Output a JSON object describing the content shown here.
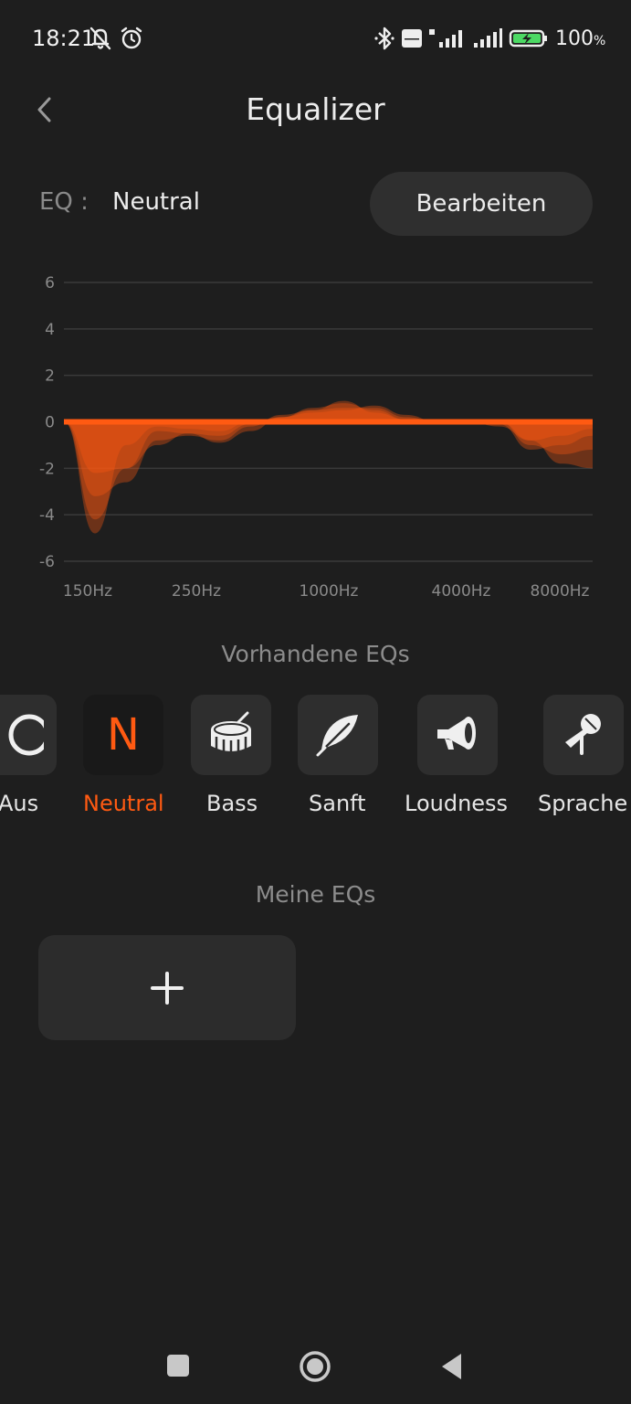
{
  "status_bar": {
    "time": "18:21",
    "battery_percent": "100",
    "battery_unit": "%",
    "icons": [
      "bell-off-icon",
      "alarm-icon",
      "bluetooth-icon",
      "volte-icon",
      "signal-4g-icon",
      "signal-icon",
      "battery-charging-icon"
    ],
    "battery_level": 1.0
  },
  "header": {
    "title": "Equalizer",
    "back_icon": "chevron-left-icon"
  },
  "eq_row": {
    "label": "EQ :",
    "value": "Neutral",
    "edit_button": "Bearbeiten"
  },
  "chart_data": {
    "type": "area",
    "y_ticks": [
      "6",
      "4",
      "2",
      "0",
      "-2",
      "-4",
      "-6"
    ],
    "y_tick_values": [
      6,
      4,
      2,
      0,
      -2,
      -4,
      -6
    ],
    "ylim": [
      -6,
      6
    ],
    "x_labels": [
      "150Hz",
      "250Hz",
      "1000Hz",
      "4000Hz",
      "8000Hz"
    ],
    "grid": true,
    "fill_color": "#ff5a12",
    "series": [
      {
        "values": [
          0,
          -4.8,
          -1.0,
          -0.2,
          -0.3,
          -0.4,
          0,
          0.2,
          0.5,
          0.9,
          0.4,
          0.1,
          0,
          0,
          0,
          -0.8,
          -1.8,
          -2.0
        ]
      },
      {
        "values": [
          0,
          -4.2,
          -2.0,
          -0.4,
          -0.5,
          -0.6,
          -0.1,
          0.2,
          0.6,
          0.8,
          0.5,
          0.1,
          0,
          0,
          0,
          -1.0,
          -1.4,
          -1.2
        ]
      },
      {
        "values": [
          0,
          -3.2,
          -2.6,
          -0.8,
          -0.6,
          -0.8,
          -0.2,
          0.3,
          0.5,
          0.6,
          0.6,
          0.2,
          0,
          0,
          -0.1,
          -1.2,
          -1.0,
          -0.6
        ]
      },
      {
        "values": [
          0,
          -2.2,
          -2.0,
          -1.0,
          -0.5,
          -0.9,
          -0.4,
          0.2,
          0.4,
          0.5,
          0.7,
          0.3,
          0,
          0,
          -0.2,
          -0.8,
          -0.6,
          -0.3
        ]
      }
    ]
  },
  "presets": {
    "title": "Vorhandene EQs",
    "items": [
      {
        "label": "Aus",
        "icon": "circle-off-icon",
        "active": false
      },
      {
        "label": "Neutral",
        "icon": "neutral-n-icon",
        "letter": "N",
        "active": true
      },
      {
        "label": "Bass",
        "icon": "drum-icon",
        "active": false
      },
      {
        "label": "Sanft",
        "icon": "feather-icon",
        "active": false
      },
      {
        "label": "Loudness",
        "icon": "megaphone-icon",
        "active": false
      },
      {
        "label": "Sprache",
        "icon": "microphone-icon",
        "active": false
      }
    ],
    "accent_color": "#ff5a12"
  },
  "my_eqs": {
    "title": "Meine EQs",
    "add_icon": "plus-icon"
  },
  "nav_bar": {
    "icons": [
      "recents-square-icon",
      "home-circle-icon",
      "back-triangle-icon"
    ]
  }
}
